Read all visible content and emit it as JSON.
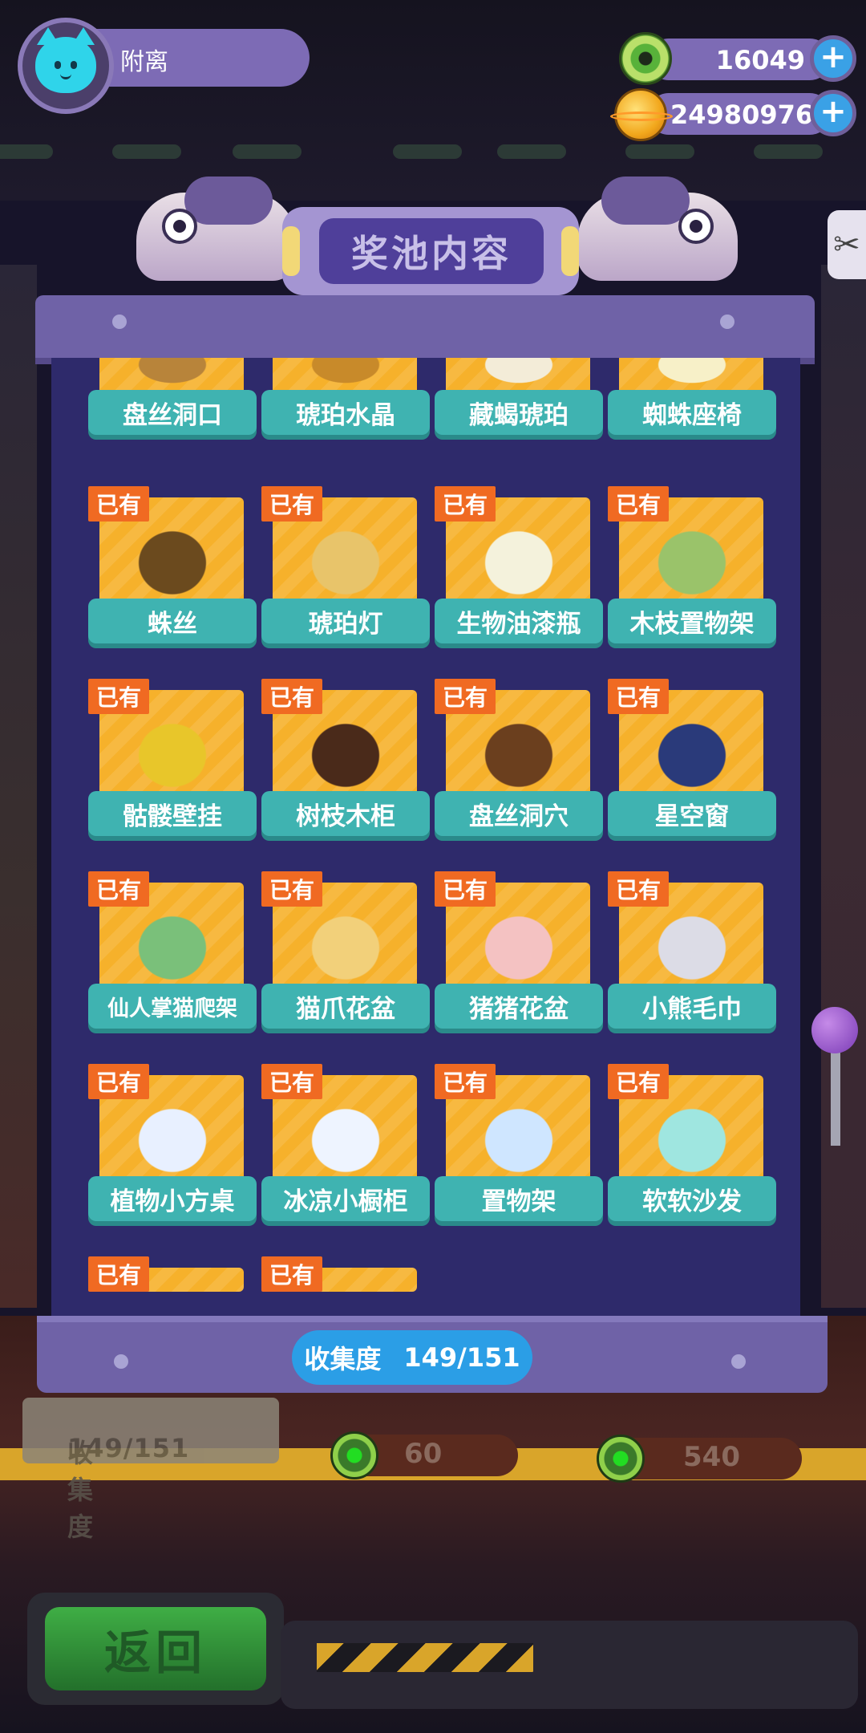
{
  "player": {
    "name": "附离",
    "avatar_icon": "cat-face-icon"
  },
  "currencies": [
    {
      "name": "donut-coin",
      "value": "16049",
      "icon": "donut-coin-icon"
    },
    {
      "name": "planet-coin",
      "value": "24980976",
      "icon": "planet-coin-icon"
    }
  ],
  "panel": {
    "title": "奖池内容",
    "collection_label": "收集度",
    "collection_value": "149/151",
    "owned_tag": "已有"
  },
  "items": [
    {
      "name": "盘丝洞口",
      "owned": true,
      "icon": "cage-door-icon"
    },
    {
      "name": "琥珀水晶",
      "owned": true,
      "icon": "amber-vase-icon"
    },
    {
      "name": "藏蝎琥珀",
      "owned": true,
      "icon": "amber-stone-icon"
    },
    {
      "name": "蜘蛛座椅",
      "owned": true,
      "icon": "spider-chair-icon"
    },
    {
      "name": "蛛丝",
      "owned": true,
      "icon": "web-frame-icon"
    },
    {
      "name": "琥珀灯",
      "owned": true,
      "icon": "amber-lamp-icon"
    },
    {
      "name": "生物油漆瓶",
      "owned": true,
      "icon": "paint-table-icon"
    },
    {
      "name": "木枝置物架",
      "owned": true,
      "icon": "branch-shelf-icon"
    },
    {
      "name": "骷髅壁挂",
      "owned": true,
      "icon": "skull-throne-icon"
    },
    {
      "name": "树枝木柜",
      "owned": true,
      "icon": "candelabra-icon"
    },
    {
      "name": "盘丝洞穴",
      "owned": true,
      "icon": "brown-panel-icon"
    },
    {
      "name": "星空窗",
      "owned": true,
      "icon": "starry-window-icon"
    },
    {
      "name": "仙人掌猫爬架",
      "owned": true,
      "icon": "cactus-cat-tree-icon"
    },
    {
      "name": "猫爪花盆",
      "owned": true,
      "icon": "paw-flowerpot-icon"
    },
    {
      "name": "猪猪花盆",
      "owned": true,
      "icon": "pig-flowerpot-icon"
    },
    {
      "name": "小熊毛巾",
      "owned": true,
      "icon": "bear-towel-icon"
    },
    {
      "name": "植物小方桌",
      "owned": true,
      "icon": "plant-table-icon"
    },
    {
      "name": "冰凉小橱柜",
      "owned": true,
      "icon": "cool-cabinet-icon"
    },
    {
      "name": "置物架",
      "owned": true,
      "icon": "shelf-icon"
    },
    {
      "name": "软软沙发",
      "owned": true,
      "icon": "soft-sofa-icon"
    },
    {
      "name": "",
      "owned": true,
      "icon": ""
    },
    {
      "name": "",
      "owned": true,
      "icon": ""
    }
  ],
  "background": {
    "collection_label": "收集度",
    "collection_value": "149/151",
    "prices": [
      "60",
      "540"
    ],
    "back_label": "返回"
  },
  "colors": {
    "panel_bg": "#2e2a6b",
    "card_bg": "#f6b12b",
    "label_bg": "#3fb3b1",
    "owned_tag": "#f06a22",
    "collect_pill": "#2b9ee6"
  }
}
